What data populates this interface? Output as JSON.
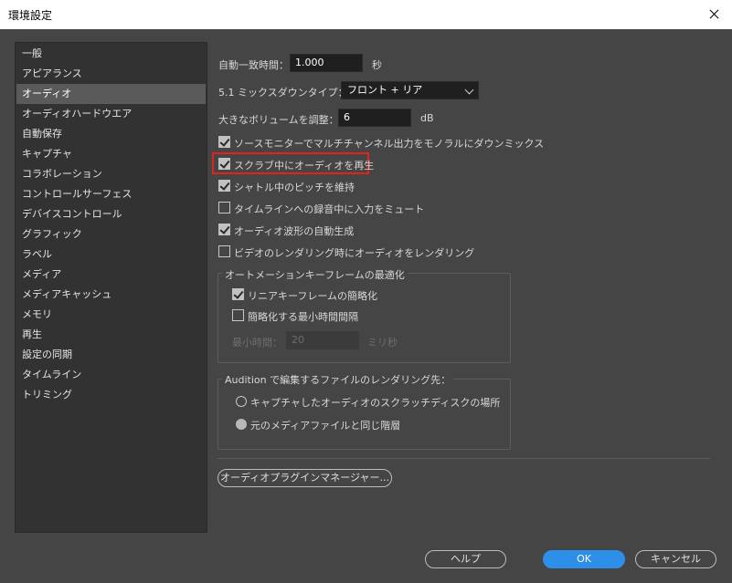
{
  "window": {
    "title": "環境設定"
  },
  "sidebar": {
    "items": [
      {
        "label": "一般"
      },
      {
        "label": "アピアランス"
      },
      {
        "label": "オーディオ"
      },
      {
        "label": "オーディオハードウエア"
      },
      {
        "label": "自動保存"
      },
      {
        "label": "キャプチャ"
      },
      {
        "label": "コラボレーション"
      },
      {
        "label": "コントロールサーフェス"
      },
      {
        "label": "デバイスコントロール"
      },
      {
        "label": "グラフィック"
      },
      {
        "label": "ラベル"
      },
      {
        "label": "メディア"
      },
      {
        "label": "メディアキャッシュ"
      },
      {
        "label": "メモリ"
      },
      {
        "label": "再生"
      },
      {
        "label": "設定の同期"
      },
      {
        "label": "タイムライン"
      },
      {
        "label": "トリミング"
      }
    ],
    "selected": "オーディオ"
  },
  "audio": {
    "auto_match_label": "自動一致時間：",
    "auto_match_value": "1.000",
    "auto_match_unit": "秒",
    "downmix_label": "5.1 ミックスダウンタイプ：",
    "downmix_value": "フロント + リア",
    "volume_label": "大きなボリュームを調整：",
    "volume_value": "6",
    "volume_unit": "dB",
    "checkboxes": [
      {
        "label": "ソースモニターでマルチチャンネル出力をモノラルにダウンミックス",
        "checked": true
      },
      {
        "label": "スクラブ中にオーディオを再生",
        "checked": true
      },
      {
        "label": "シャトル中のピッチを維持",
        "checked": true
      },
      {
        "label": "タイムラインへの録音中に入力をミュート",
        "checked": false
      },
      {
        "label": "オーディオ波形の自動生成",
        "checked": true
      },
      {
        "label": "ビデオのレンダリング時にオーディオをレンダリング",
        "checked": false
      }
    ],
    "automation": {
      "title": "オートメーションキーフレームの最適化",
      "linear_label": "リニアキーフレームの簡略化",
      "linear_checked": true,
      "min_interval_label": "簡略化する最小時間間隔",
      "min_interval_checked": false,
      "min_time_label": "最小時間：",
      "min_time_value": "20",
      "min_time_unit": "ミリ秒"
    },
    "audition": {
      "title": "Audition で編集するファイルのレンダリング先：",
      "options": [
        {
          "label": "キャプチャしたオーディオのスクラッチディスクの場所",
          "selected": false
        },
        {
          "label": "元のメディアファイルと同じ階層",
          "selected": true
        }
      ]
    },
    "plugin_manager_label": "オーディオプラグインマネージャー..."
  },
  "footer": {
    "help_label": "ヘルプ",
    "ok_label": "OK",
    "cancel_label": "キャンセル"
  }
}
